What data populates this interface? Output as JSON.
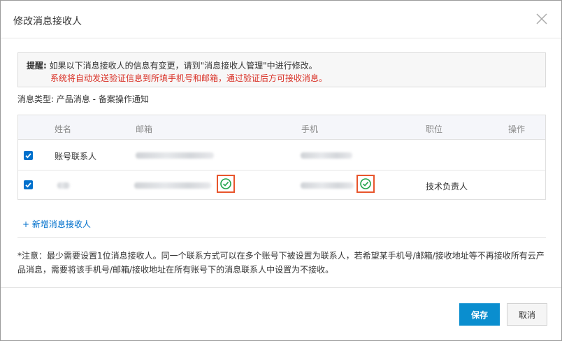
{
  "dialog": {
    "title": "修改消息接收人",
    "close_icon": "close-icon"
  },
  "notice": {
    "label": "提醒:",
    "text": "如果以下消息接收人的信息有变更，请到\"消息接收人管理\"中进行修改。",
    "warning": "系统将自动发送验证信息到所填手机号和邮箱，通过验证后方可接收消息。"
  },
  "message_type": {
    "text": "消息类型: 产品消息 - 备案操作通知"
  },
  "table": {
    "headers": {
      "name": "姓名",
      "email": "邮箱",
      "phone": "手机",
      "position": "职位",
      "action": "操作"
    },
    "rows": [
      {
        "checked": true,
        "name": "账号联系人",
        "position": ""
      },
      {
        "checked": true,
        "name": "",
        "position": "技术负责人"
      }
    ]
  },
  "add_recipient": {
    "label": "+ 新增消息接收人"
  },
  "note": {
    "text": "*注意：最少需要设置1位消息接收人。同一个联系方式可以在多个账号下被设置为联系人，若希望某手机号/邮箱/接收地址等不再接收所有云产品消息，需要将该手机号/邮箱/接收地址在所有账号下的消息联系人中设置为不接收。"
  },
  "buttons": {
    "save": "保存",
    "cancel": "取消"
  },
  "colors": {
    "primary": "#0a8ecf",
    "link": "#0070cc",
    "warning_text": "#d93026",
    "verified": "#22a34a",
    "highlight_border": "#e8552c"
  }
}
